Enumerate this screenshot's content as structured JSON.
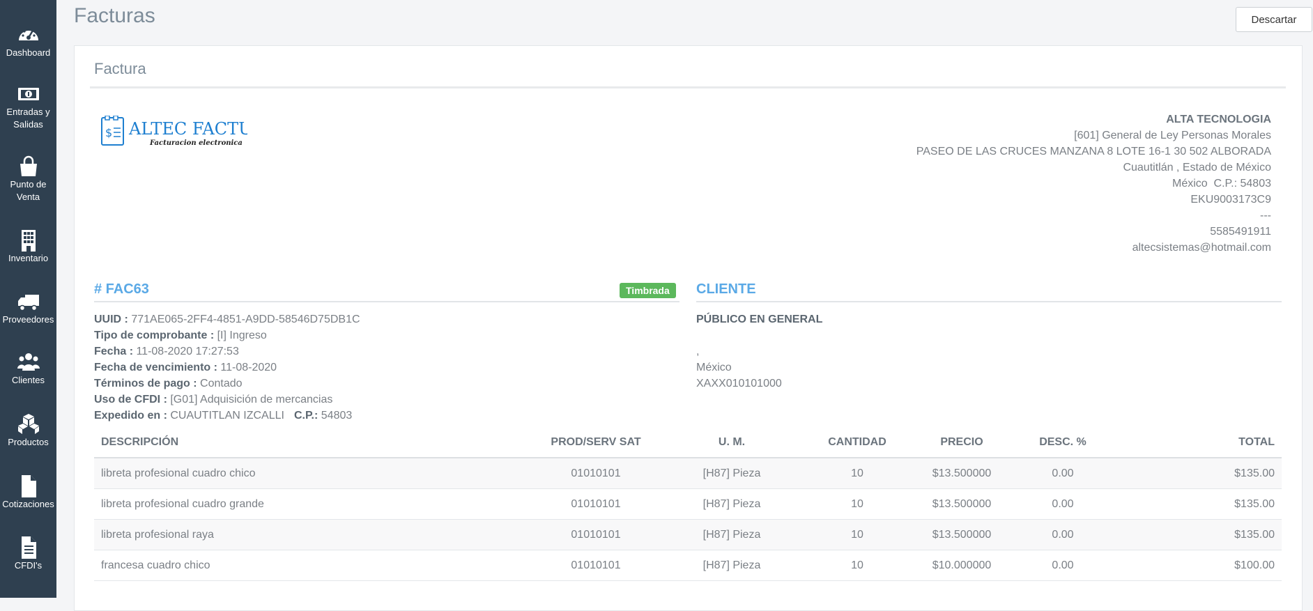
{
  "sidebar": {
    "items": [
      {
        "label": "Dashboard",
        "icon": "dashboard-gauge-icon"
      },
      {
        "label": "Entradas y Salidas",
        "icon": "money-bill-icon"
      },
      {
        "label": "Punto de Venta",
        "icon": "shopping-bag-icon"
      },
      {
        "label": "Inventario",
        "icon": "building-icon"
      },
      {
        "label": "Proveedores",
        "icon": "truck-icon"
      },
      {
        "label": "Clientes",
        "icon": "users-icon"
      },
      {
        "label": "Productos",
        "icon": "cubes-icon"
      },
      {
        "label": "Cotizaciones",
        "icon": "file-icon"
      },
      {
        "label": "CFDI's",
        "icon": "file-text-icon"
      }
    ]
  },
  "header": {
    "title": "Facturas",
    "discard_label": "Descartar"
  },
  "panel": {
    "title": "Factura"
  },
  "logo": {
    "text": "ALTEC FACTURA",
    "subtitle": "Facturacion electronica",
    "color": "#1e7fd0"
  },
  "company": {
    "name": "ALTA TECNOLOGIA",
    "regime": "[601] General de Ley Personas Morales",
    "address": "PASEO DE LAS CRUCES MANZANA 8 LOTE 16-1 30 502 ALBORADA",
    "city_state": "Cuautitlán , Estado de México",
    "country_cp": "México  C.P.: 54803",
    "rfc": "EKU9003173C9",
    "dashes": "---",
    "phone": "5585491911",
    "email": "altecsistemas@hotmail.com"
  },
  "invoice": {
    "number_label": "# FAC63",
    "status": "Timbrada",
    "status_color": "#5cb85c",
    "uuid_label": "UUID : ",
    "uuid": "771AE065-2FF4-4851-A9DD-58546D75DB1C",
    "tipo_label": "Tipo de comprobante : ",
    "tipo": "[I] Ingreso",
    "fecha_label": "Fecha : ",
    "fecha": "11-08-2020 17:27:53",
    "venc_label": "Fecha de vencimiento : ",
    "venc": "11-08-2020",
    "terminos_label": "Términos de pago : ",
    "terminos": "Contado",
    "uso_label": "Uso de CFDI : ",
    "uso": "[G01] Adquisición de mercancias",
    "expedido_label": "Expedido en : ",
    "expedido": "CUAUTITLAN IZCALLI",
    "cp_label": "C.P.: ",
    "cp": "54803"
  },
  "client": {
    "heading": "CLIENTE",
    "name": "PÚBLICO EN GENERAL",
    "comma": ",",
    "country": "México",
    "rfc": "XAXX010101000"
  },
  "table": {
    "headers": [
      "DESCRIPCIÓN",
      "PROD/SERV SAT",
      "U. M.",
      "CANTIDAD",
      "PRECIO",
      "DESC. %",
      "TOTAL"
    ],
    "rows": [
      [
        "libreta profesional cuadro chico",
        "01010101",
        "[H87] Pieza",
        "10",
        "$13.500000",
        "0.00",
        "$135.00"
      ],
      [
        "libreta profesional cuadro grande",
        "01010101",
        "[H87] Pieza",
        "10",
        "$13.500000",
        "0.00",
        "$135.00"
      ],
      [
        "libreta profesional raya",
        "01010101",
        "[H87] Pieza",
        "10",
        "$13.500000",
        "0.00",
        "$135.00"
      ],
      [
        "francesa cuadro chico",
        "01010101",
        "[H87] Pieza",
        "10",
        "$10.000000",
        "0.00",
        "$100.00"
      ]
    ]
  },
  "colors": {
    "sidebar_bg": "#2f4050",
    "accent": "#5aa9e6"
  }
}
